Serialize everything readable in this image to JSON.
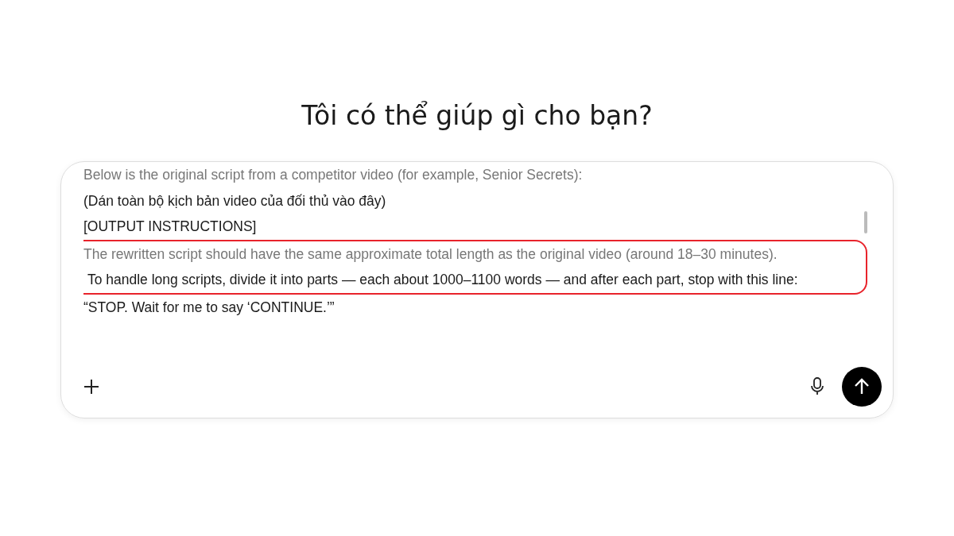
{
  "heading": "Tôi có thể giúp gì cho bạn?",
  "composer": {
    "lines": [
      {
        "text": "Below is the original script from a competitor video (for example, Senior Secrets):",
        "highlighted": false
      },
      {
        "text": "(Dán toàn bộ kịch bản video của đối thủ vào đây)",
        "highlighted": false
      },
      {
        "text": "[OUTPUT INSTRUCTIONS]",
        "highlighted": false
      },
      {
        "text": "The rewritten script should have the same approximate total length as the original video (around 18–30 minutes).",
        "highlighted": true
      },
      {
        "text": " To handle long scripts, divide it into parts — each about 1000–1100 words — and after each part, stop with this line:",
        "highlighted": true
      },
      {
        "text": "“STOP. Wait for me to say ‘CONTINUE.’”",
        "highlighted": false
      }
    ]
  }
}
